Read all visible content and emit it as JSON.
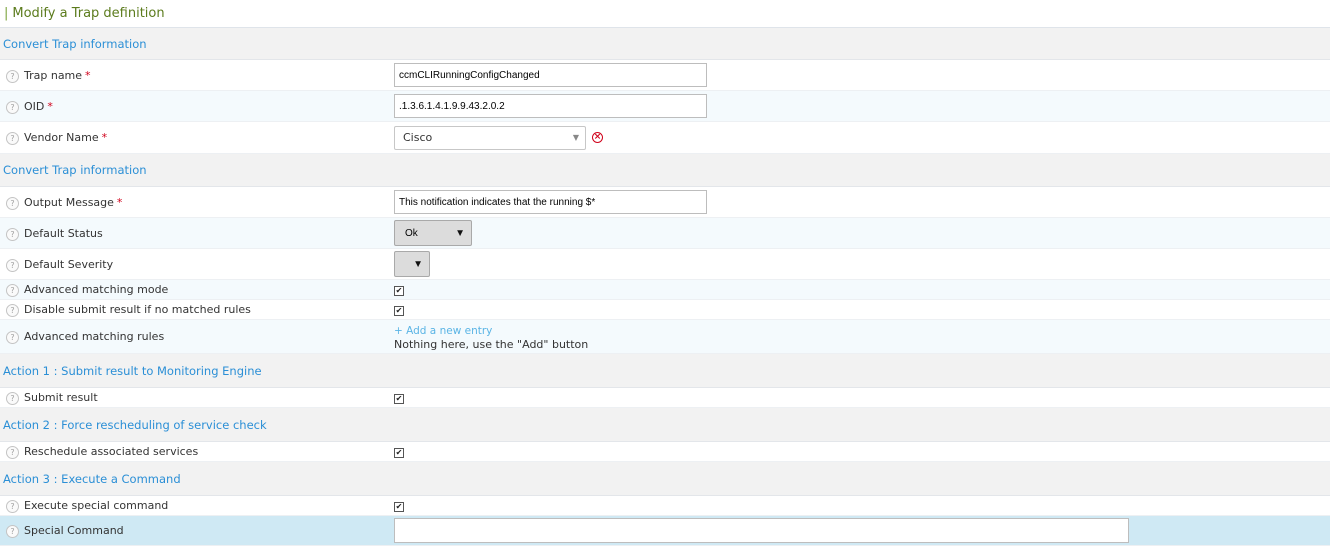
{
  "header": {
    "bar": "|",
    "title": "Modify a Trap definition"
  },
  "required_mark": "*",
  "help_glyph": "?",
  "sections": {
    "convert_info_1": "Convert Trap information",
    "convert_info_2": "Convert Trap information",
    "action1": "Action 1 : Submit result to Monitoring Engine",
    "action2": "Action 2 : Force rescheduling of service check",
    "action3": "Action 3 : Execute a Command"
  },
  "fields": {
    "trap_name": {
      "label": "Trap name",
      "value": "ccmCLIRunningConfigChanged"
    },
    "oid": {
      "label": "OID",
      "value": ".1.3.6.1.4.1.9.9.43.2.0.2"
    },
    "vendor_name": {
      "label": "Vendor Name",
      "value": "Cisco"
    },
    "output_message": {
      "label": "Output Message",
      "value": "This notification indicates that the running $*"
    },
    "default_status": {
      "label": "Default Status",
      "value": "Ok"
    },
    "default_severity": {
      "label": "Default Severity",
      "value": ""
    },
    "advanced_matching_mode": {
      "label": "Advanced matching mode",
      "checked": true
    },
    "disable_submit": {
      "label": "Disable submit result if no matched rules",
      "checked": true
    },
    "advanced_matching_rules": {
      "label": "Advanced matching rules",
      "add_link": "+ Add a new entry",
      "empty_text": "Nothing here, use the \"Add\" button"
    },
    "submit_result": {
      "label": "Submit result",
      "checked": true
    },
    "reschedule_services": {
      "label": "Reschedule associated services",
      "checked": true
    },
    "execute_special_command": {
      "label": "Execute special command",
      "checked": true
    },
    "special_command": {
      "label": "Special Command",
      "value": ""
    }
  },
  "colors": {
    "header_title": "#5b7b1c",
    "section_title": "#2b8fd6",
    "required": "#d0021b",
    "link": "#5ab4e5",
    "selected_row": "#cfe9f4"
  }
}
